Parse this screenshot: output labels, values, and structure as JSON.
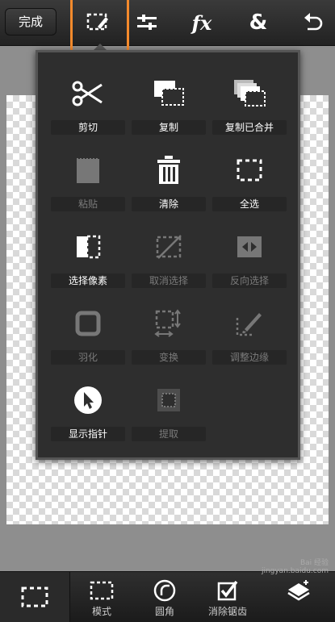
{
  "toolbar": {
    "done_label": "完成",
    "fx_label": "fx",
    "amp_label": "&"
  },
  "menu": {
    "items": [
      {
        "label": "剪切",
        "icon": "scissors-icon",
        "enabled": true
      },
      {
        "label": "复制",
        "icon": "copy-icon",
        "enabled": true
      },
      {
        "label": "复制已合并",
        "icon": "copy-merged-icon",
        "enabled": true
      },
      {
        "label": "粘贴",
        "icon": "paste-icon",
        "enabled": false
      },
      {
        "label": "清除",
        "icon": "trash-icon",
        "enabled": true
      },
      {
        "label": "全选",
        "icon": "select-all-icon",
        "enabled": true
      },
      {
        "label": "选择像素",
        "icon": "select-pixels-icon",
        "enabled": true
      },
      {
        "label": "取消选择",
        "icon": "deselect-icon",
        "enabled": false
      },
      {
        "label": "反向选择",
        "icon": "invert-selection-icon",
        "enabled": false
      },
      {
        "label": "羽化",
        "icon": "feather-icon",
        "enabled": false
      },
      {
        "label": "变换",
        "icon": "transform-icon",
        "enabled": false
      },
      {
        "label": "调整边缘",
        "icon": "refine-edge-icon",
        "enabled": false
      },
      {
        "label": "显示指针",
        "icon": "show-pointer-icon",
        "enabled": true
      },
      {
        "label": "提取",
        "icon": "extract-icon",
        "enabled": false
      }
    ]
  },
  "bottombar": {
    "mode_label": "模式",
    "round_label": "圆角",
    "antialias_label": "消除锯齿"
  },
  "watermark": {
    "line1": "Bai 经验",
    "line2": "jingyan.baidu.com"
  }
}
